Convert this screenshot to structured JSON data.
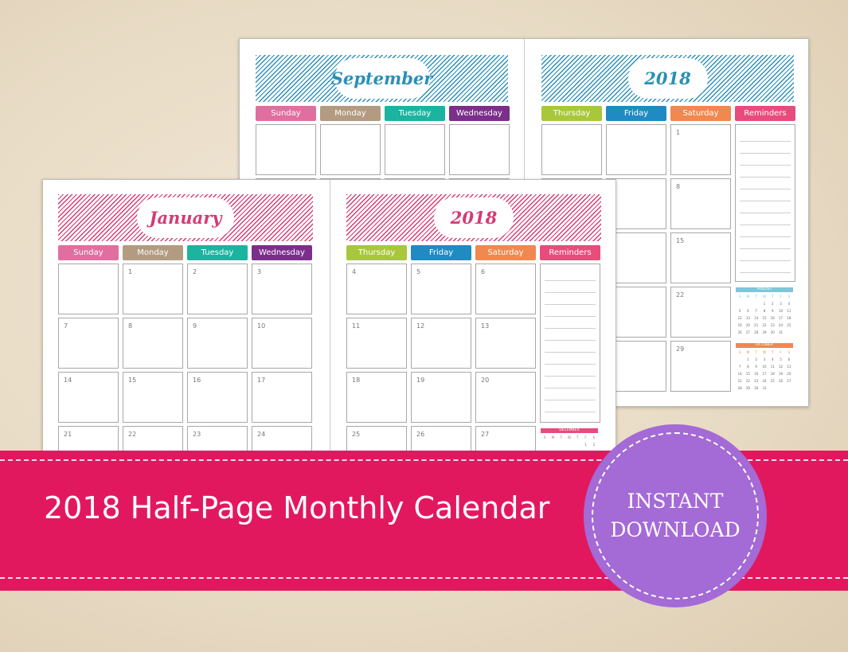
{
  "colors": {
    "banner": "#e2185f",
    "badge": "#a46ad6",
    "sunday": "#e06fa0",
    "monday": "#b29b80",
    "tuesday": "#1cb3a0",
    "wednesday": "#7b2f8b",
    "thursday": "#a8c73b",
    "friday": "#1f8bc2",
    "saturday": "#f0884f",
    "reminders": "#e84c7c",
    "stripe_blue": "#2b8fb5",
    "stripe_pink": "#d63a75"
  },
  "back_page": {
    "month": "September",
    "year": "2018",
    "stripe_color": "#2b8fb5",
    "left_days": [
      "Sunday",
      "Monday",
      "Tuesday",
      "Wednesday"
    ],
    "right_days": [
      "Thursday",
      "Friday",
      "Saturday",
      "Reminders"
    ],
    "left_rows": [
      [
        "",
        "",
        "",
        ""
      ]
    ],
    "right_rows": [
      [
        "",
        "",
        "1"
      ],
      [
        "",
        "",
        "8"
      ],
      [
        "",
        "",
        "15"
      ],
      [
        "",
        "",
        "22"
      ],
      [
        "",
        "",
        "29"
      ]
    ],
    "minis": [
      {
        "title": "AUGUST",
        "color": "#7fc6dc",
        "weekdays": [
          "S",
          "M",
          "T",
          "W",
          "T",
          "F",
          "S"
        ],
        "dates": [
          "",
          "",
          "",
          "1",
          "2",
          "3",
          "4",
          "5",
          "6",
          "7",
          "8",
          "9",
          "10",
          "11",
          "12",
          "13",
          "14",
          "15",
          "16",
          "17",
          "18",
          "19",
          "20",
          "21",
          "22",
          "23",
          "24",
          "25",
          "26",
          "27",
          "28",
          "29",
          "30",
          "31"
        ]
      },
      {
        "title": "OCTOBER",
        "color": "#f0884f",
        "weekdays": [
          "S",
          "M",
          "T",
          "W",
          "T",
          "F",
          "S"
        ],
        "dates": [
          "",
          "1",
          "2",
          "3",
          "4",
          "5",
          "6",
          "7",
          "8",
          "9",
          "10",
          "11",
          "12",
          "13",
          "14",
          "15",
          "16",
          "17",
          "18",
          "19",
          "20",
          "21",
          "22",
          "23",
          "24",
          "25",
          "26",
          "27",
          "28",
          "29",
          "30",
          "31"
        ]
      }
    ]
  },
  "front_page": {
    "month": "January",
    "year": "2018",
    "stripe_color": "#d63a75",
    "left_days": [
      "Sunday",
      "Monday",
      "Tuesday",
      "Wednesday"
    ],
    "right_days": [
      "Thursday",
      "Friday",
      "Saturday",
      "Reminders"
    ],
    "left_rows": [
      [
        "",
        "1",
        "2",
        "3"
      ],
      [
        "7",
        "8",
        "9",
        "10"
      ],
      [
        "14",
        "15",
        "16",
        "17"
      ],
      [
        "21",
        "22",
        "23",
        "24"
      ]
    ],
    "right_rows": [
      [
        "4",
        "5",
        "6"
      ],
      [
        "11",
        "12",
        "13"
      ],
      [
        "18",
        "19",
        "20"
      ],
      [
        "25",
        "26",
        "27"
      ]
    ],
    "minis": [
      {
        "title": "DECEMBER",
        "color": "#e84c7c",
        "weekdays": [
          "S",
          "M",
          "T",
          "W",
          "T",
          "F",
          "S"
        ],
        "dates": [
          "",
          "",
          "",
          "",
          "",
          "1",
          "2"
        ]
      }
    ]
  },
  "banner": {
    "title": "2018 Half-Page Monthly Calendar"
  },
  "badge": {
    "line1": "INSTANT",
    "line2": "DOWNLOAD"
  }
}
